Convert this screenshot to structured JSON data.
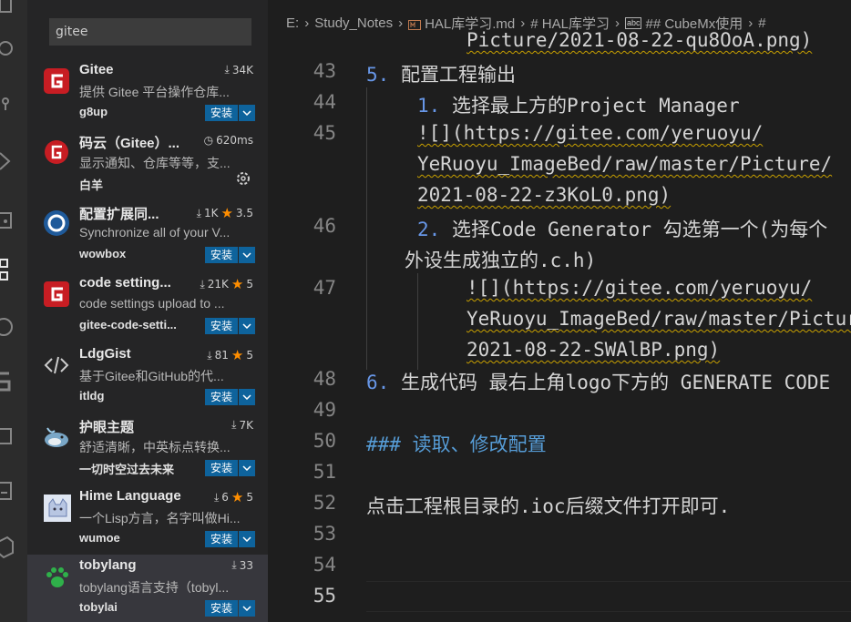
{
  "activity_bar": {
    "icons": [
      "explorer-icon",
      "search-icon",
      "source-control-icon",
      "run-debug-icon",
      "remote-explorer-icon",
      "extensions-icon",
      "github-icon",
      "gitee-icon",
      "pages-icon",
      "notebook-icon",
      "cube-icon"
    ]
  },
  "search": {
    "value": "gitee"
  },
  "extensions": [
    {
      "name": "Gitee",
      "downloads": "34K",
      "description": "提供 Gitee 平台操作仓库...",
      "publisher": "g8up",
      "action": "安装",
      "icon": "gitee-logo-icon"
    },
    {
      "name": "码云（Gitee）...",
      "install_time": "620ms",
      "description": "显示通知、仓库等等，支...",
      "publisher": "白羊",
      "icon": "gitee-round-logo-icon"
    },
    {
      "name": "配置扩展同...",
      "downloads": "1K",
      "rating": "3.5",
      "description": "Synchronize all of your V...",
      "publisher": "wowbox",
      "action": "安装",
      "icon": "sync-logo-icon"
    },
    {
      "name": "code setting...",
      "downloads": "21K",
      "rating": "5",
      "description": "code settings upload to ...",
      "publisher": "gitee-code-setti...",
      "action": "安装",
      "icon": "gitee-logo-icon"
    },
    {
      "name": "LdgGist",
      "downloads": "81",
      "rating": "5",
      "description": "基于Gitee和GitHub的代...",
      "publisher": "itldg",
      "action": "安装",
      "icon": "code-brackets-icon"
    },
    {
      "name": "护眼主题",
      "downloads": "7K",
      "description": "舒适清晰，中英标点转换...",
      "publisher": "一切时空过去未来",
      "action": "安装",
      "icon": "whale-icon"
    },
    {
      "name": "Hime Language",
      "downloads": "6",
      "rating": "5",
      "description": "一个Lisp方言，名字叫做Hi...",
      "publisher": "wumoe",
      "action": "安装",
      "icon": "cat-icon"
    },
    {
      "name": "tobylang",
      "downloads": "33",
      "description": "tobylang语言支持（tobyl...",
      "publisher": "tobylai",
      "action": "安装",
      "icon": "paw-icon"
    }
  ],
  "breadcrumb": [
    "E:",
    "Study_Notes",
    "HAL库学习.md",
    "# HAL库学习",
    "## CubeMx使用",
    "#"
  ],
  "editor": {
    "top_partial": "Picture/2021-08-22-qu8OoA.png)",
    "lines": [
      {
        "n": "43",
        "num": "5.",
        "text": "配置工程输出"
      },
      {
        "n": "44",
        "num": "1.",
        "text": "选择最上方的Project Manager"
      },
      {
        "n": "45",
        "text": "![](https://gitee.com/yeruoyu/"
      },
      {
        "text": "YeRuoyu_ImageBed/raw/master/Picture/"
      },
      {
        "text": "2021-08-22-z3KoL0.png)"
      },
      {
        "n": "46",
        "num": "2.",
        "text": "选择Code Generator  勾选第一个(为每个"
      },
      {
        "text": "外设生成独立的.c.h)"
      },
      {
        "n": "47",
        "text": "![](https://gitee.com/yeruoyu/"
      },
      {
        "text": "YeRuoyu_ImageBed/raw/master/Picture/"
      },
      {
        "text": "2021-08-22-SWAlBP.png)"
      },
      {
        "n": "48",
        "num": "6.",
        "text": "生成代码 最右上角logo下方的 GENERATE CODE"
      },
      {
        "n": "49",
        "text": ""
      },
      {
        "n": "50",
        "head": "###",
        "text": "读取、修改配置"
      },
      {
        "n": "51",
        "text": ""
      },
      {
        "n": "52",
        "text": "点击工程根目录的.ioc后缀文件打开即可."
      },
      {
        "n": "53",
        "text": ""
      },
      {
        "n": "54",
        "text": ""
      },
      {
        "n": "55",
        "text": ""
      }
    ]
  },
  "colors": {
    "install_button": "#0e639c",
    "star": "#ff8e00",
    "list_number": "#6796e6",
    "heading": "#569cd6",
    "squiggle": "#c8a000"
  }
}
